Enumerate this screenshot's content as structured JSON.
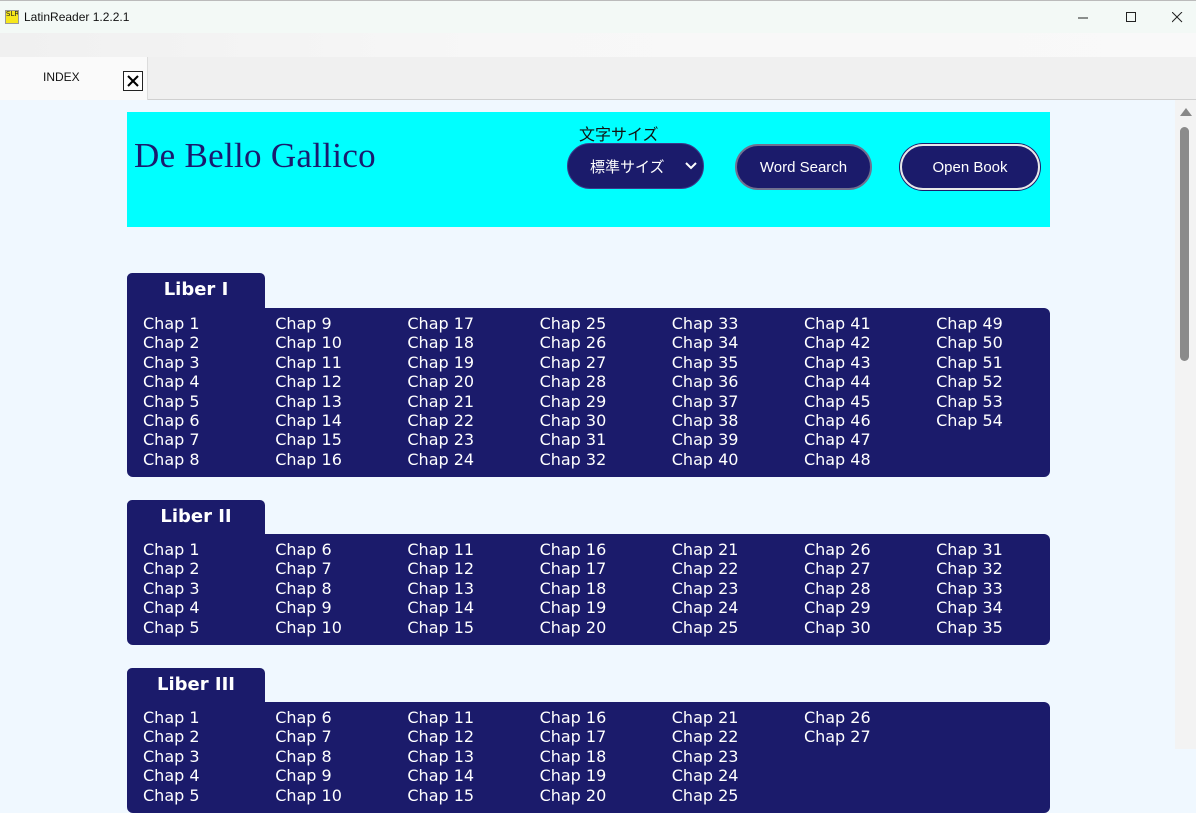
{
  "window": {
    "title": "LatinReader 1.2.2.1",
    "icon_text": "SLR"
  },
  "tabs": [
    {
      "label": "INDEX"
    }
  ],
  "header": {
    "book_title": "De Bello Gallico",
    "font_size_label": "文字サイズ",
    "font_size_value": "標準サイズ",
    "word_search_label": "Word Search",
    "open_book_label": "Open Book",
    "background_color": "#00ffff",
    "accent_color": "#1b1b6b"
  },
  "libri": [
    {
      "title": "Liber I",
      "chapters": 54,
      "rows": 8
    },
    {
      "title": "Liber II",
      "chapters": 35,
      "rows": 5
    },
    {
      "title": "Liber III",
      "chapters": 27,
      "rows": 5
    }
  ],
  "chapter_prefix": "Chap"
}
